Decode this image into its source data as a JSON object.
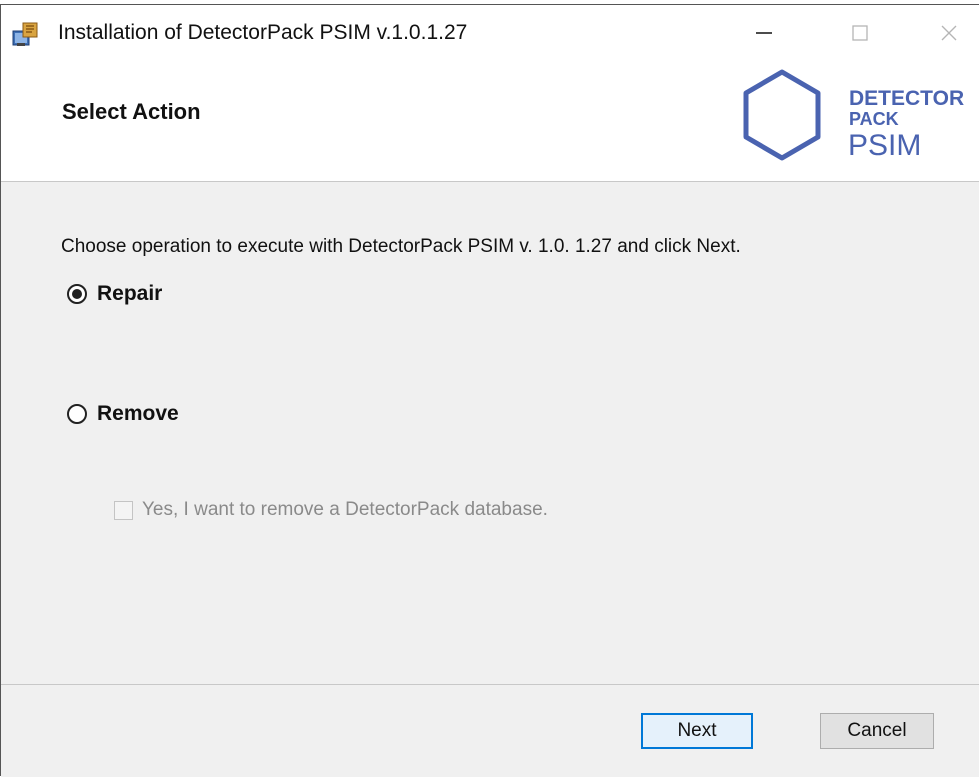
{
  "window": {
    "title": "Installation of DetectorPack PSIM v.1.0.1.27",
    "minimize_glyph": "—",
    "icon": "installer-icon"
  },
  "header": {
    "title": "Select Action",
    "logo": {
      "line1": "DETECTOR",
      "line2": "PACK",
      "line3": "PSIM",
      "color": "#4a63b0"
    }
  },
  "content": {
    "instruction": "Choose operation to execute with DetectorPack PSIM v. 1.0. 1.27 and click Next.",
    "options": [
      {
        "label": "Repair",
        "selected": true
      },
      {
        "label": "Remove",
        "selected": false
      }
    ],
    "remove_db_checkbox": {
      "label": "Yes, I want to remove a DetectorPack database.",
      "checked": false,
      "enabled": false
    }
  },
  "footer": {
    "next_label": "Next",
    "cancel_label": "Cancel"
  },
  "colors": {
    "content_bg": "#f0f0f0",
    "accent": "#0078d7",
    "logo": "#4a63b0"
  }
}
